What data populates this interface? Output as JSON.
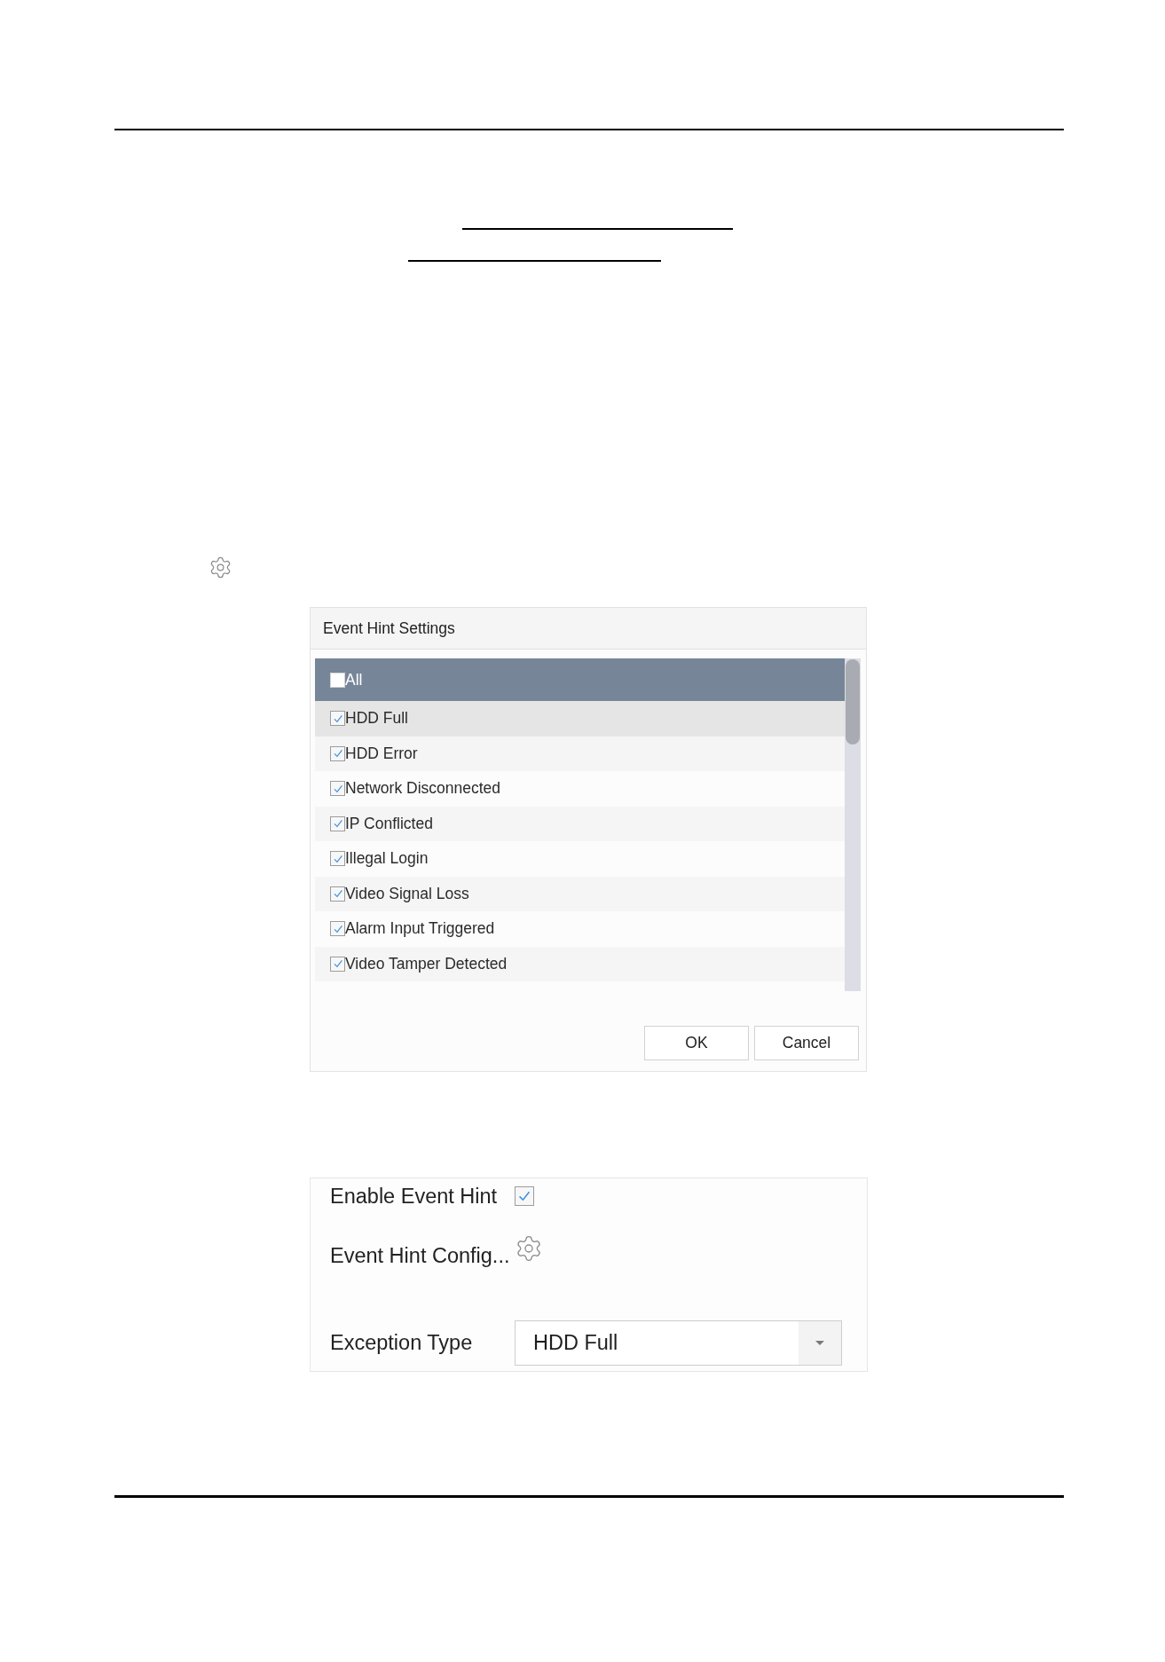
{
  "dialog": {
    "title": "Event Hint Settings",
    "select_all": {
      "label": "All",
      "checked": false
    },
    "items": [
      {
        "label": "HDD Full",
        "checked": true,
        "selected": true
      },
      {
        "label": "HDD Error",
        "checked": true,
        "selected": false
      },
      {
        "label": "Network Disconnected",
        "checked": true,
        "selected": false
      },
      {
        "label": "IP Conflicted",
        "checked": true,
        "selected": false
      },
      {
        "label": "Illegal Login",
        "checked": true,
        "selected": false
      },
      {
        "label": "Video Signal Loss",
        "checked": true,
        "selected": false
      },
      {
        "label": "Alarm Input Triggered",
        "checked": true,
        "selected": false
      },
      {
        "label": "Video Tamper Detected",
        "checked": true,
        "selected": false
      }
    ],
    "buttons": [
      "OK",
      "Cancel"
    ]
  },
  "settings_panel": {
    "rows": [
      {
        "kind": "checkbox",
        "label": "Enable Event Hint",
        "checked": true
      },
      {
        "kind": "settings",
        "label": "Event Hint Config..."
      },
      {
        "kind": "dropdown",
        "label": "Exception Type",
        "value": "HDD Full"
      }
    ]
  }
}
